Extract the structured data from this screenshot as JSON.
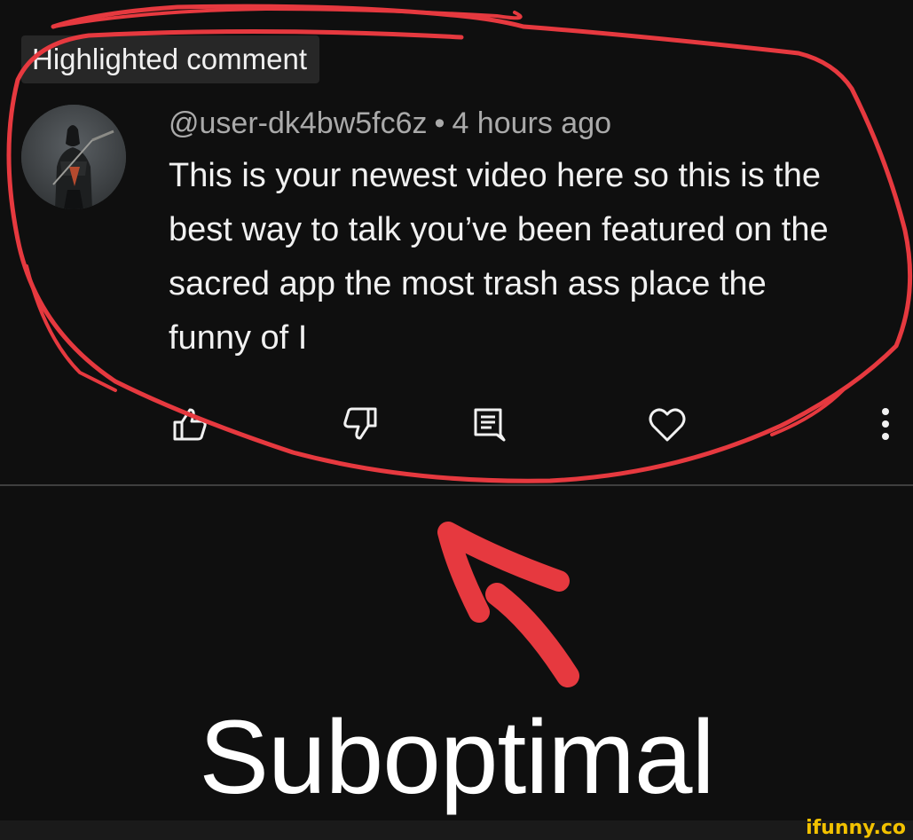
{
  "badge": {
    "label": "Highlighted comment"
  },
  "comment": {
    "handle": "@user-dk4bw5fc6z",
    "separator": "•",
    "time": "4 hours ago",
    "lines": [
      "This is your newest video here so this is the",
      "best way to talk you’ve been featured on the",
      "sacred app the most trash ass place the",
      "funny of I"
    ]
  },
  "actions": {
    "like_icon": "thumb-up-icon",
    "dislike_icon": "thumb-down-icon",
    "reply_icon": "reply-comment-icon",
    "heart_icon": "heart-icon",
    "more_icon": "more-vertical-icon"
  },
  "caption": "Suboptimal",
  "watermark": "ifunny.co",
  "colors": {
    "background": "#0f0f0f",
    "annotation": "#e6393f",
    "watermark": "#f2c100"
  }
}
